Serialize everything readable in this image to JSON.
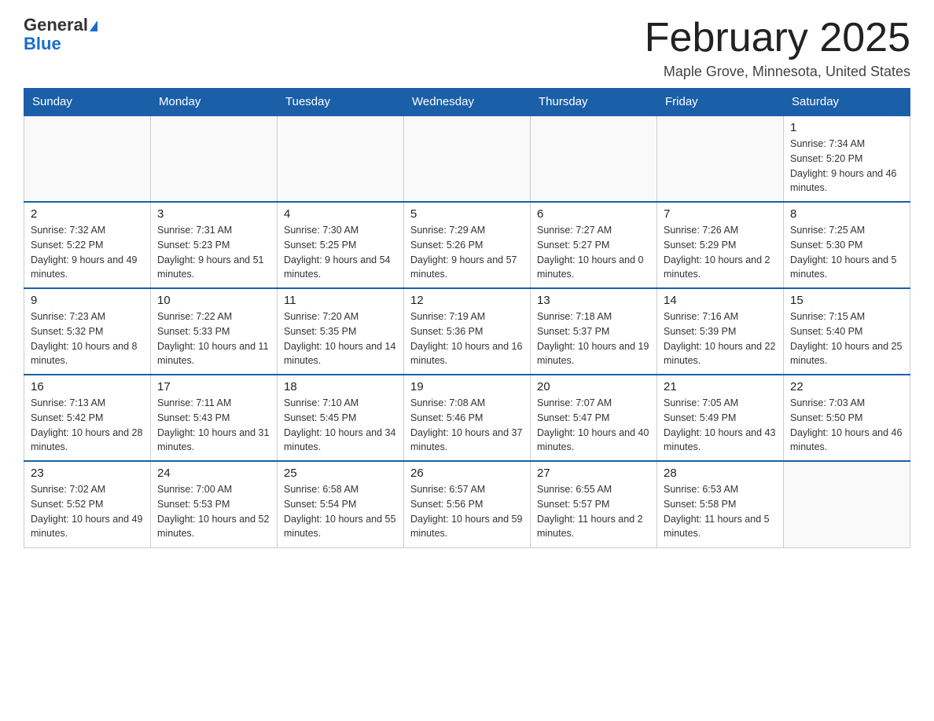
{
  "header": {
    "logo_general": "General",
    "logo_blue": "Blue",
    "month_title": "February 2025",
    "subtitle": "Maple Grove, Minnesota, United States"
  },
  "weekdays": [
    "Sunday",
    "Monday",
    "Tuesday",
    "Wednesday",
    "Thursday",
    "Friday",
    "Saturday"
  ],
  "weeks": [
    [
      {
        "day": "",
        "info": ""
      },
      {
        "day": "",
        "info": ""
      },
      {
        "day": "",
        "info": ""
      },
      {
        "day": "",
        "info": ""
      },
      {
        "day": "",
        "info": ""
      },
      {
        "day": "",
        "info": ""
      },
      {
        "day": "1",
        "info": "Sunrise: 7:34 AM\nSunset: 5:20 PM\nDaylight: 9 hours and 46 minutes."
      }
    ],
    [
      {
        "day": "2",
        "info": "Sunrise: 7:32 AM\nSunset: 5:22 PM\nDaylight: 9 hours and 49 minutes."
      },
      {
        "day": "3",
        "info": "Sunrise: 7:31 AM\nSunset: 5:23 PM\nDaylight: 9 hours and 51 minutes."
      },
      {
        "day": "4",
        "info": "Sunrise: 7:30 AM\nSunset: 5:25 PM\nDaylight: 9 hours and 54 minutes."
      },
      {
        "day": "5",
        "info": "Sunrise: 7:29 AM\nSunset: 5:26 PM\nDaylight: 9 hours and 57 minutes."
      },
      {
        "day": "6",
        "info": "Sunrise: 7:27 AM\nSunset: 5:27 PM\nDaylight: 10 hours and 0 minutes."
      },
      {
        "day": "7",
        "info": "Sunrise: 7:26 AM\nSunset: 5:29 PM\nDaylight: 10 hours and 2 minutes."
      },
      {
        "day": "8",
        "info": "Sunrise: 7:25 AM\nSunset: 5:30 PM\nDaylight: 10 hours and 5 minutes."
      }
    ],
    [
      {
        "day": "9",
        "info": "Sunrise: 7:23 AM\nSunset: 5:32 PM\nDaylight: 10 hours and 8 minutes."
      },
      {
        "day": "10",
        "info": "Sunrise: 7:22 AM\nSunset: 5:33 PM\nDaylight: 10 hours and 11 minutes."
      },
      {
        "day": "11",
        "info": "Sunrise: 7:20 AM\nSunset: 5:35 PM\nDaylight: 10 hours and 14 minutes."
      },
      {
        "day": "12",
        "info": "Sunrise: 7:19 AM\nSunset: 5:36 PM\nDaylight: 10 hours and 16 minutes."
      },
      {
        "day": "13",
        "info": "Sunrise: 7:18 AM\nSunset: 5:37 PM\nDaylight: 10 hours and 19 minutes."
      },
      {
        "day": "14",
        "info": "Sunrise: 7:16 AM\nSunset: 5:39 PM\nDaylight: 10 hours and 22 minutes."
      },
      {
        "day": "15",
        "info": "Sunrise: 7:15 AM\nSunset: 5:40 PM\nDaylight: 10 hours and 25 minutes."
      }
    ],
    [
      {
        "day": "16",
        "info": "Sunrise: 7:13 AM\nSunset: 5:42 PM\nDaylight: 10 hours and 28 minutes."
      },
      {
        "day": "17",
        "info": "Sunrise: 7:11 AM\nSunset: 5:43 PM\nDaylight: 10 hours and 31 minutes."
      },
      {
        "day": "18",
        "info": "Sunrise: 7:10 AM\nSunset: 5:45 PM\nDaylight: 10 hours and 34 minutes."
      },
      {
        "day": "19",
        "info": "Sunrise: 7:08 AM\nSunset: 5:46 PM\nDaylight: 10 hours and 37 minutes."
      },
      {
        "day": "20",
        "info": "Sunrise: 7:07 AM\nSunset: 5:47 PM\nDaylight: 10 hours and 40 minutes."
      },
      {
        "day": "21",
        "info": "Sunrise: 7:05 AM\nSunset: 5:49 PM\nDaylight: 10 hours and 43 minutes."
      },
      {
        "day": "22",
        "info": "Sunrise: 7:03 AM\nSunset: 5:50 PM\nDaylight: 10 hours and 46 minutes."
      }
    ],
    [
      {
        "day": "23",
        "info": "Sunrise: 7:02 AM\nSunset: 5:52 PM\nDaylight: 10 hours and 49 minutes."
      },
      {
        "day": "24",
        "info": "Sunrise: 7:00 AM\nSunset: 5:53 PM\nDaylight: 10 hours and 52 minutes."
      },
      {
        "day": "25",
        "info": "Sunrise: 6:58 AM\nSunset: 5:54 PM\nDaylight: 10 hours and 55 minutes."
      },
      {
        "day": "26",
        "info": "Sunrise: 6:57 AM\nSunset: 5:56 PM\nDaylight: 10 hours and 59 minutes."
      },
      {
        "day": "27",
        "info": "Sunrise: 6:55 AM\nSunset: 5:57 PM\nDaylight: 11 hours and 2 minutes."
      },
      {
        "day": "28",
        "info": "Sunrise: 6:53 AM\nSunset: 5:58 PM\nDaylight: 11 hours and 5 minutes."
      },
      {
        "day": "",
        "info": ""
      }
    ]
  ]
}
